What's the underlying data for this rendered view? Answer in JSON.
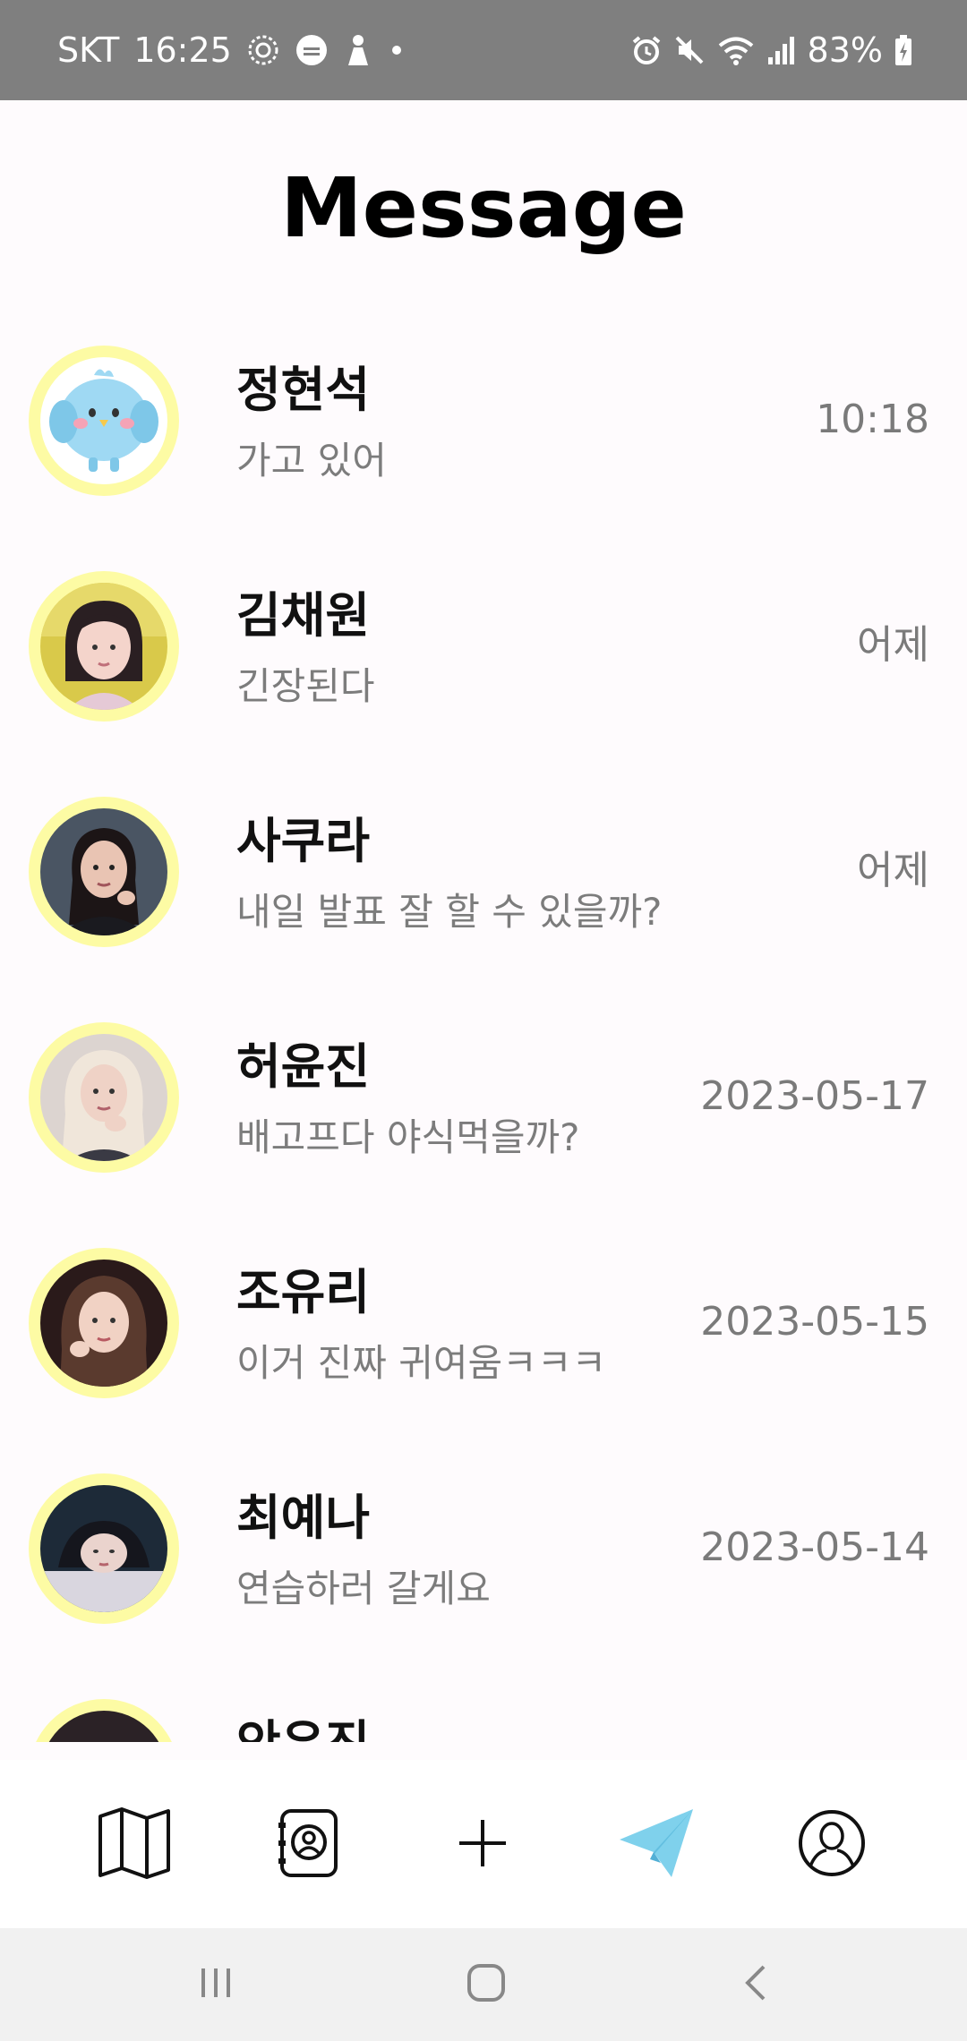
{
  "status_bar": {
    "carrier": "SKT",
    "time": "16:25",
    "battery": "83%",
    "left_icons": [
      "gear-badge-icon",
      "lock-app-icon",
      "figure-icon",
      "dot-icon"
    ],
    "right_icons": [
      "alarm-icon",
      "mute-icon",
      "wifi-icon",
      "signal-icon",
      "battery-charging-icon"
    ]
  },
  "page": {
    "title": "Message"
  },
  "conversations": [
    {
      "name": "정현석",
      "preview": "가고 있어",
      "time": "10:18",
      "avatar": "bird-avatar"
    },
    {
      "name": "김채원",
      "preview": "긴장된다",
      "time": "어제",
      "avatar": "photo-avatar"
    },
    {
      "name": "사쿠라",
      "preview": "내일 발표 잘 할 수 있을까?",
      "time": "어제",
      "avatar": "photo-avatar"
    },
    {
      "name": "허윤진",
      "preview": "배고프다 야식먹을까?",
      "time": "2023-05-17",
      "avatar": "photo-avatar"
    },
    {
      "name": "조유리",
      "preview": "이거 진짜 귀여움ㅋㅋㅋ",
      "time": "2023-05-15",
      "avatar": "photo-avatar"
    },
    {
      "name": "최예나",
      "preview": "연습하러 갈게요",
      "time": "2023-05-14",
      "avatar": "photo-avatar"
    },
    {
      "name": "안유진",
      "preview": "",
      "time": "",
      "avatar": "photo-avatar"
    }
  ],
  "bottom_nav": {
    "items": [
      {
        "icon": "map-icon",
        "active": false
      },
      {
        "icon": "contacts-book-icon",
        "active": false
      },
      {
        "icon": "plus-icon",
        "active": false
      },
      {
        "icon": "paper-plane-icon",
        "active": true
      },
      {
        "icon": "profile-icon",
        "active": false
      }
    ],
    "active_color": "#7fd1ec"
  },
  "system_nav": {
    "items": [
      "recent-apps-icon",
      "home-icon",
      "back-icon"
    ]
  },
  "colors": {
    "background": "#fefbfd",
    "status_bar": "#7f7f7f",
    "avatar_ring": "#fdfba4",
    "secondary_text": "#7a7a7a"
  }
}
